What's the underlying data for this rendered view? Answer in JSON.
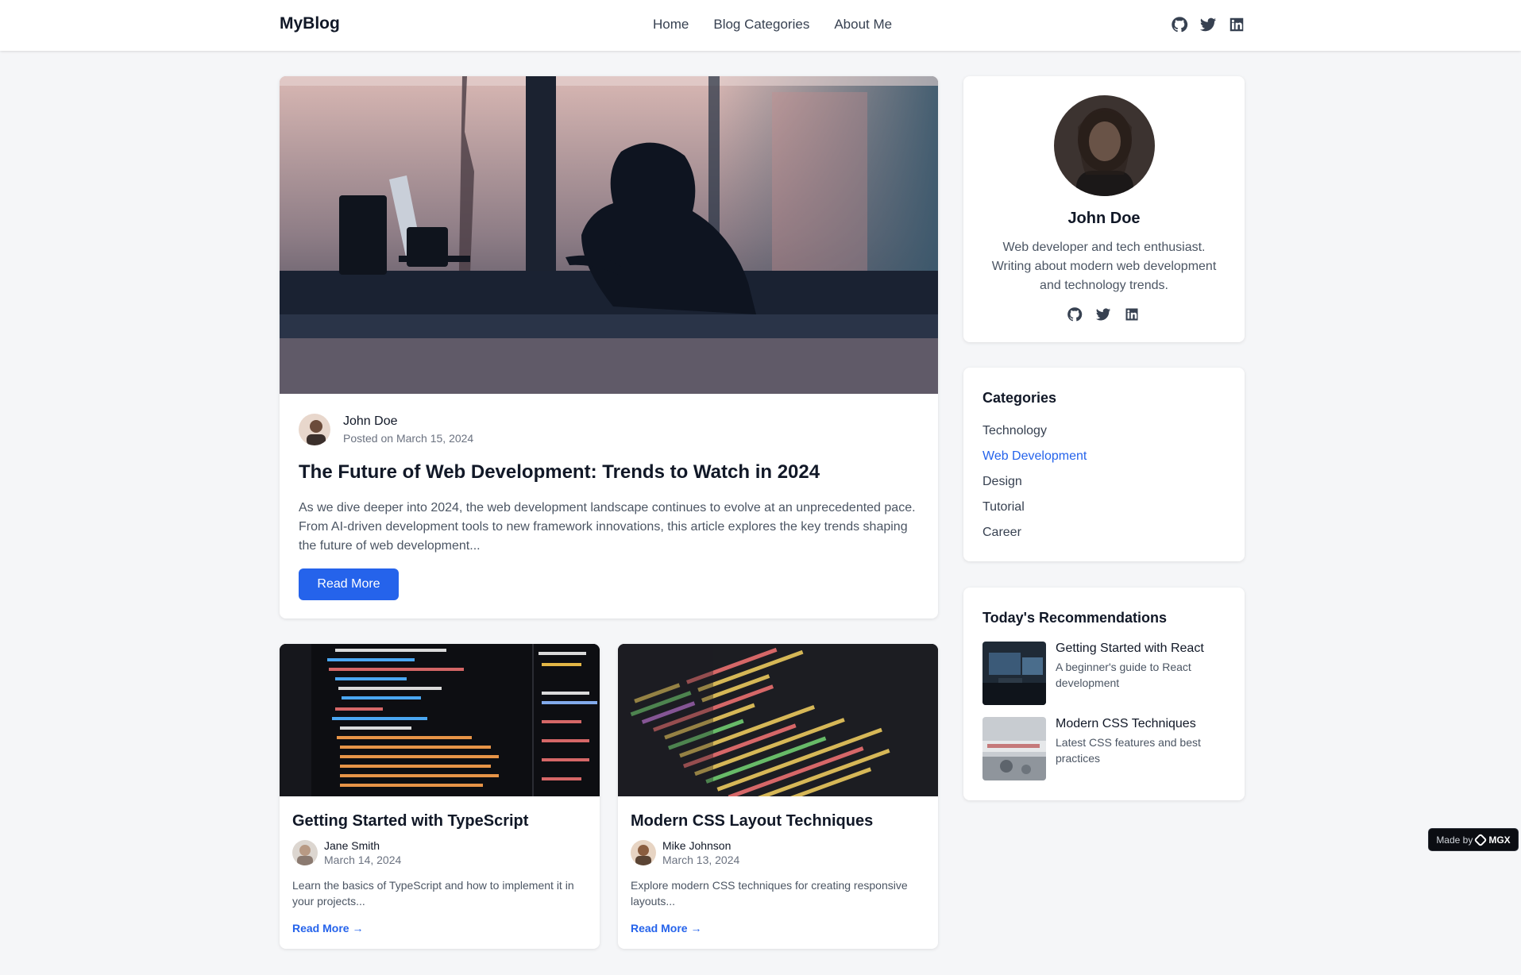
{
  "header": {
    "brand": "MyBlog",
    "nav": [
      "Home",
      "Blog Categories",
      "About Me"
    ],
    "social_icons": [
      "github-icon",
      "twitter-icon",
      "linkedin-icon"
    ]
  },
  "featured": {
    "author": "John Doe",
    "date": "Posted on March 15, 2024",
    "title": "The Future of Web Development: Trends to Watch in 2024",
    "excerpt": "As we dive deeper into 2024, the web development landscape continues to evolve at an unprecedented pace. From AI-driven development tools to new framework innovations, this article explores the key trends shaping the future of web development...",
    "button": "Read More"
  },
  "posts": [
    {
      "title": "Getting Started with TypeScript",
      "author": "Jane Smith",
      "date": "March 14, 2024",
      "excerpt": "Learn the basics of TypeScript and how to implement it in your projects...",
      "link": "Read More →"
    },
    {
      "title": "Modern CSS Layout Techniques",
      "author": "Mike Johnson",
      "date": "March 13, 2024",
      "excerpt": "Explore modern CSS techniques for creating responsive layouts...",
      "link": "Read More →"
    }
  ],
  "profile": {
    "name": "John Doe",
    "bio": "Web developer and tech enthusiast. Writing about modern web development and technology trends."
  },
  "categories": {
    "heading": "Categories",
    "items": [
      "Technology",
      "Web Development",
      "Design",
      "Tutorial",
      "Career"
    ],
    "active": "Web Development"
  },
  "recommendations": {
    "heading": "Today's Recommendations",
    "items": [
      {
        "title": "Getting Started with React",
        "desc": "A beginner's guide to React development"
      },
      {
        "title": "Modern CSS Techniques",
        "desc": "Latest CSS features and best practices"
      }
    ]
  },
  "badge": {
    "prefix": "Made by",
    "brand": "MGX"
  },
  "colors": {
    "accent": "#2563eb",
    "background": "#f5f6f8"
  }
}
